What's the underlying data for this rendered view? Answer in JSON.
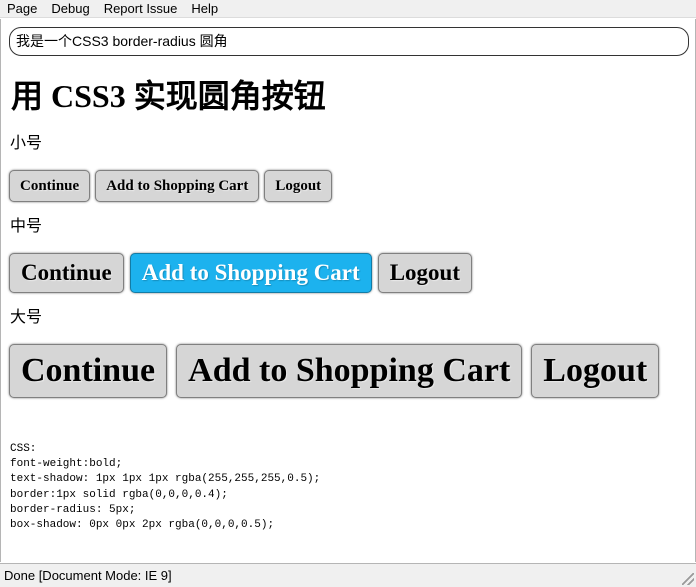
{
  "menu": [
    "Page",
    "Debug",
    "Report Issue",
    "Help"
  ],
  "title_box": "我是一个CSS3 border-radius 圆角",
  "heading": "用 CSS3 实现圆角按钮",
  "sections": {
    "small": {
      "label": "小号",
      "buttons": [
        "Continue",
        "Add to Shopping Cart",
        "Logout"
      ]
    },
    "medium": {
      "label": "中号",
      "buttons": [
        "Continue",
        "Add to Shopping Cart",
        "Logout"
      ],
      "active_index": 1
    },
    "large": {
      "label": "大号",
      "buttons": [
        "Continue",
        "Add to Shopping Cart",
        "Logout"
      ]
    }
  },
  "css_code": [
    "CSS:",
    "font-weight:bold;",
    "text-shadow: 1px 1px 1px rgba(255,255,255,0.5);",
    "border:1px solid rgba(0,0,0,0.4);",
    "border-radius: 5px;",
    "box-shadow: 0px 0px 2px rgba(0,0,0,0.5);"
  ],
  "status": "Done [Document Mode: IE 9]",
  "colors": {
    "button_bg": "#d6d6d6",
    "active_button_bg": "#1cb2ee"
  },
  "icons": {
    "resize_grip": "resize-grip-icon"
  }
}
